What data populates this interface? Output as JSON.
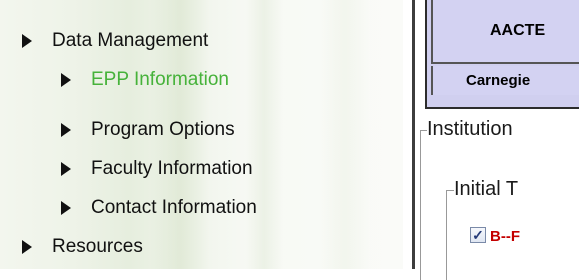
{
  "nav": {
    "items": [
      {
        "label": "Data Management",
        "level": 0,
        "active": false
      },
      {
        "label": "EPP Information",
        "level": 1,
        "active": true
      },
      {
        "label": "Program Options",
        "level": 1,
        "active": false
      },
      {
        "label": "Faculty Information",
        "level": 1,
        "active": false
      },
      {
        "label": "Contact Information",
        "level": 1,
        "active": false
      },
      {
        "label": "Resources",
        "level": 0,
        "active": false
      }
    ],
    "active_color": "#46b23a"
  },
  "table": {
    "header": "AACTE",
    "row": "Carnegie"
  },
  "fieldsets": {
    "outer_legend": "Institution",
    "inner_legend": "Initial T"
  },
  "checkbox": {
    "checked": true,
    "label": "B--F",
    "label_color": "#c40000"
  },
  "icons": {
    "nav_bullet": "triangle-right-icon",
    "checkbox": "checkmark-icon"
  }
}
